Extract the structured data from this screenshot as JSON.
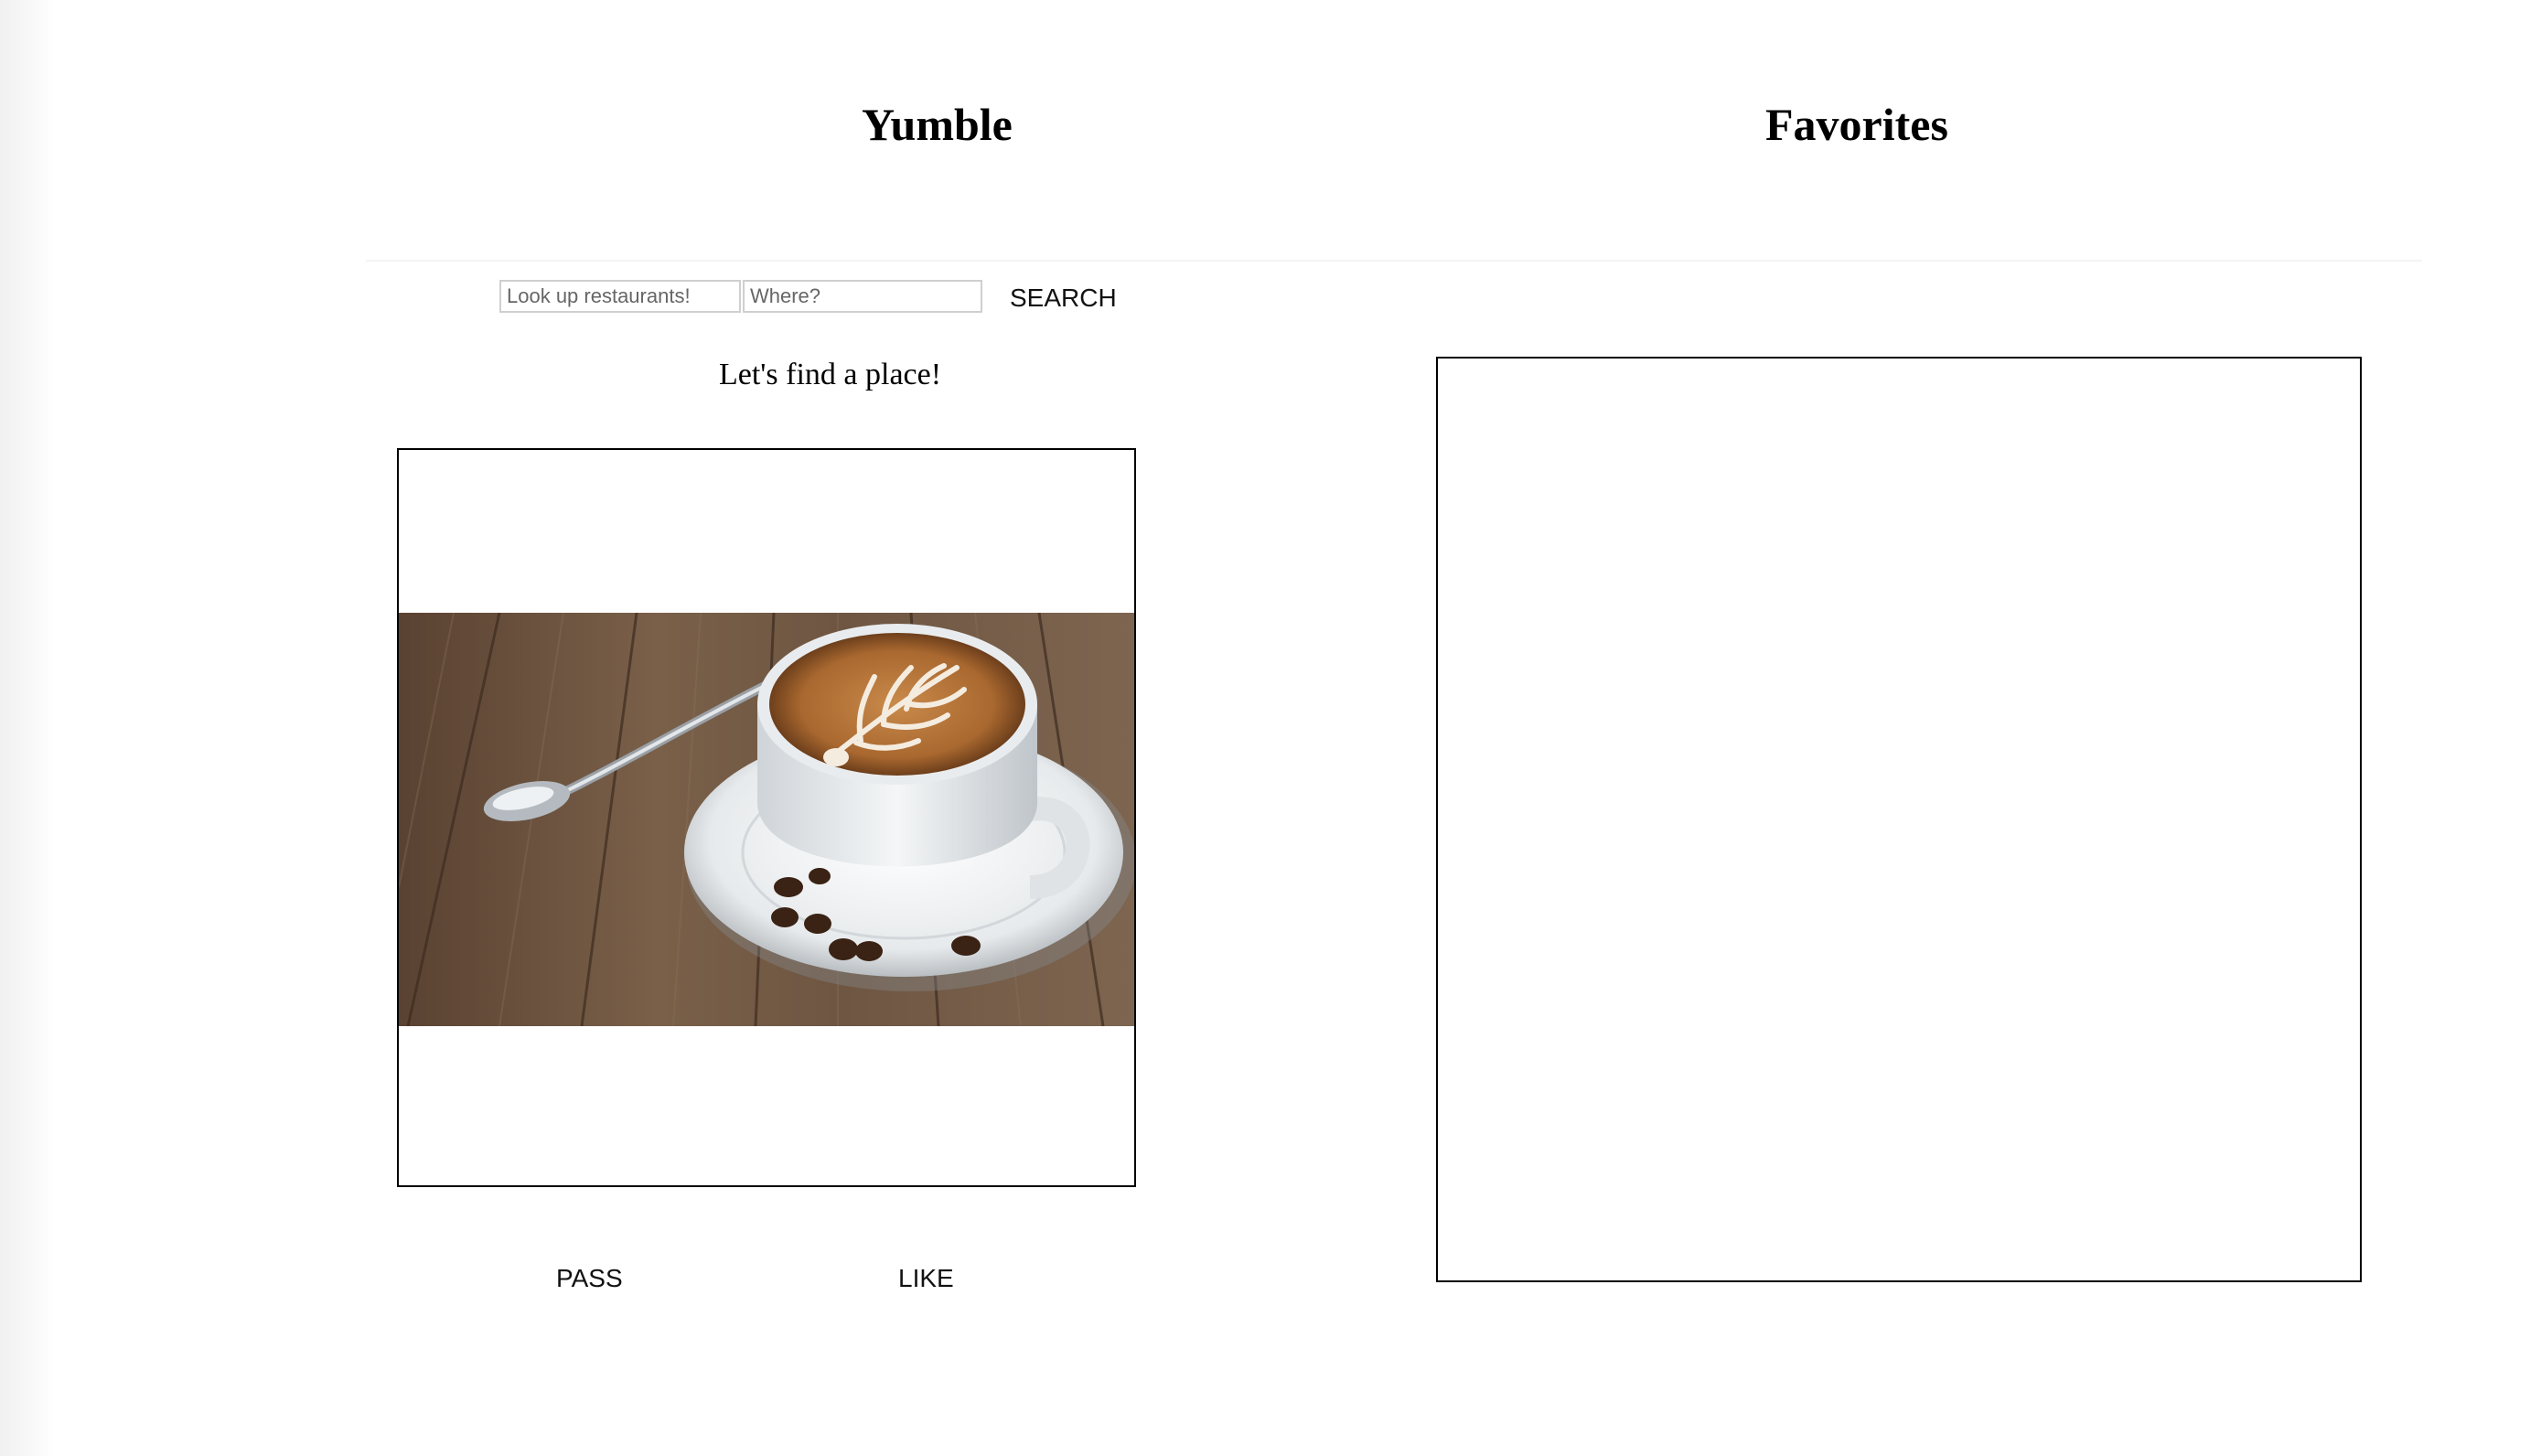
{
  "app": {
    "title": "Yumble"
  },
  "favorites": {
    "title": "Favorites"
  },
  "search": {
    "query_placeholder": "Look up restaurants!",
    "query_value": "",
    "location_placeholder": "Where?",
    "location_value": "",
    "button_label": "SEARCH"
  },
  "status": {
    "message": "Let's find a place!"
  },
  "card": {
    "image_subject": "latte art coffee cup on saucer with spoon and coffee beans on wooden table"
  },
  "actions": {
    "pass_label": "PASS",
    "like_label": "LIKE"
  },
  "colors": {
    "background": "#ffffff",
    "text": "#000000",
    "border": "#000000",
    "input_border": "#cfcfcf"
  }
}
